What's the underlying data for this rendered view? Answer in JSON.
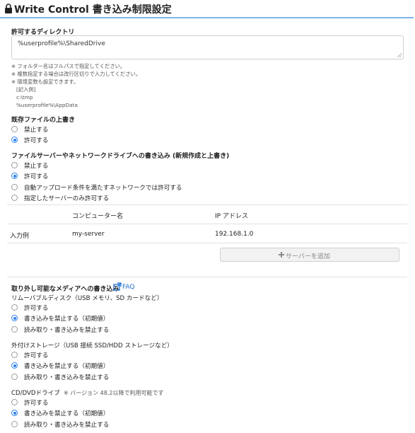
{
  "header": {
    "title": "Write Control 書き込み制限設定"
  },
  "allowed_dirs": {
    "heading": "許可するディレクトリ",
    "value": "%userprofile%\\SharedDrive",
    "notes": [
      "※ フォルダー名はフルパスで指定してください。",
      "※ 複数指定する場合は改行区切りで入力してください。",
      "※ 環境変数も設定できます。",
      "[記入例]",
      "c:\\tmp",
      "%userprofile%\\AppData"
    ]
  },
  "overwrite": {
    "heading": "既存ファイルの上書き",
    "options": [
      "禁止する",
      "許可する"
    ],
    "selected": 1
  },
  "network": {
    "heading": "ファイルサーバーやネットワークドライブへの書き込み (新規作成と上書き)",
    "options": [
      "禁止する",
      "許可する",
      "自動アップロード条件を満たすネットワークでは許可する",
      "指定したサーバーのみ許可する"
    ],
    "selected": 1,
    "table": {
      "columns": [
        "コンピューター名",
        "IP アドレス"
      ],
      "rows": [
        {
          "label": "入力例",
          "name": "my-server",
          "ip": "192.168.1.0"
        }
      ]
    },
    "add_button": "サーバーを追加"
  },
  "removable": {
    "heading": "取り外し可能なメディアへの書き込み",
    "faq": "FAQ",
    "groups": [
      {
        "title": "リムーバブルディスク（USB メモリ、SD カードなど）",
        "note": "",
        "options": [
          "許可する",
          "書き込みを禁止する（初期値）",
          "読み取り・書き込みを禁止する"
        ],
        "selected": 1
      },
      {
        "title": "外付けストレージ（USB 接続 SSD/HDD ストレージなど）",
        "note": "",
        "options": [
          "許可する",
          "書き込みを禁止する（初期値）",
          "読み取り・書き込みを禁止する"
        ],
        "selected": 1
      },
      {
        "title": "CD/DVDドライブ",
        "note": "※ バージョン 48.2以降で利用可能です",
        "options": [
          "許可する",
          "書き込みを禁止する（初期値）",
          "読み取り・書き込みを禁止する"
        ],
        "selected": 1
      }
    ]
  },
  "colors": {
    "accent": "#2f80ed",
    "header_rule": "#7fb4e6",
    "link": "#1f6fd1"
  }
}
